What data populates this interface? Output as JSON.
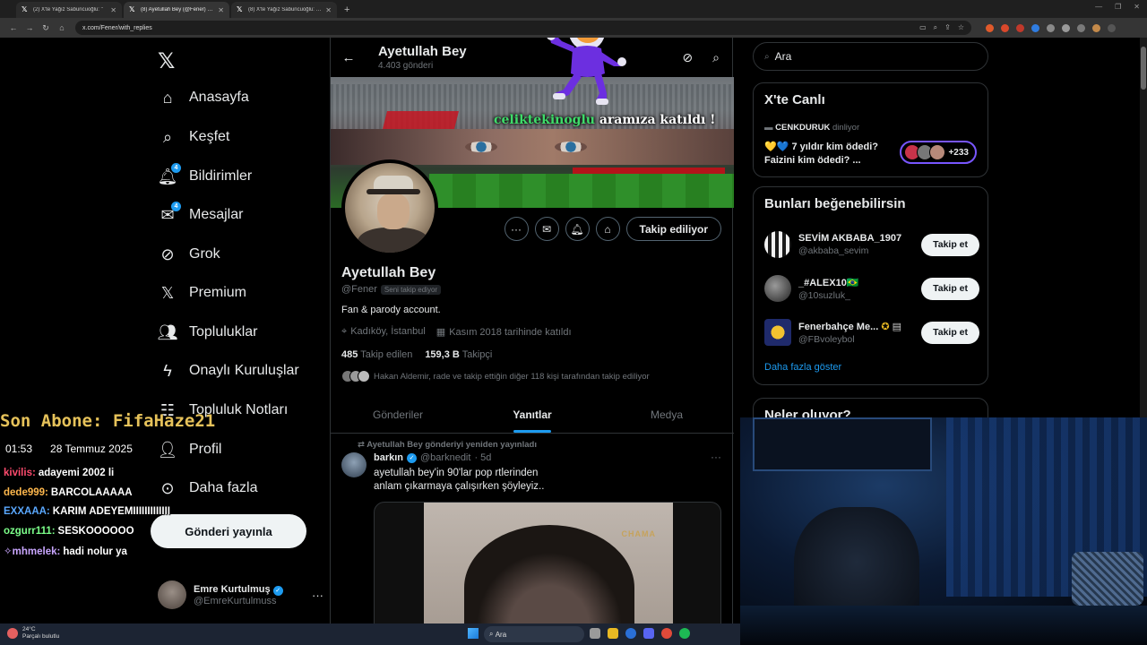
{
  "browser": {
    "tabs": [
      {
        "title": "(2) X'te Yağız Sabuncuoğlu: \"",
        "active": false
      },
      {
        "title": "(8) Ayetullah Bey (@Fener) adlı",
        "active": true
      },
      {
        "title": "(8) X'te Yağız Sabuncuoğlu: \"@",
        "active": false
      }
    ],
    "new_tab": "+",
    "url": "x.com/Fener/with_replies"
  },
  "nav": {
    "items": [
      {
        "label": "Anasayfa",
        "icon": "home-icon",
        "badge": ""
      },
      {
        "label": "Keşfet",
        "icon": "search-icon",
        "badge": ""
      },
      {
        "label": "Bildirimler",
        "icon": "bell-icon",
        "badge": "4"
      },
      {
        "label": "Mesajlar",
        "icon": "mail-icon",
        "badge": "4"
      },
      {
        "label": "Grok",
        "icon": "grok-icon",
        "badge": ""
      },
      {
        "label": "Premium",
        "icon": "x-icon",
        "badge": ""
      },
      {
        "label": "Topluluklar",
        "icon": "people-icon",
        "badge": ""
      },
      {
        "label": "Onaylı Kuruluşlar",
        "icon": "lightning-icon",
        "badge": ""
      },
      {
        "label": "Topluluk Notları",
        "icon": "notes-icon",
        "badge": ""
      },
      {
        "label": "Profil",
        "icon": "person-icon",
        "badge": ""
      },
      {
        "label": "Daha fazla",
        "icon": "more-circle-icon",
        "badge": ""
      }
    ],
    "post_button": "Gönderi yayınla",
    "account": {
      "name": "Emre Kurtulmuş",
      "handle": "@EmreKurtulmuss"
    }
  },
  "profile": {
    "header_name": "Ayetullah Bey",
    "post_count": "4.403 gönderi",
    "banner_text_user": "celiktekinoglu",
    "banner_text_rest": " aramıza katıldı !",
    "name": "Ayetullah Bey",
    "handle": "@Fener",
    "follows_you": "Seni takip ediyor",
    "bio": "Fan & parody account.",
    "location": "Kadıköy, İstanbul",
    "joined": "Kasım 2018 tarihinde katıldı",
    "following_count": "485",
    "following_label": "Takip edilen",
    "followers_count": "159,3 B",
    "followers_label": "Takipçi",
    "mutual_text": "Hakan Aldemir, rade ve takip ettiğin diğer 118 kişi tarafından takip ediliyor",
    "follow_button": "Takip ediliyor",
    "tabs": [
      {
        "label": "Gönderiler",
        "active": false
      },
      {
        "label": "Yanıtlar",
        "active": true
      },
      {
        "label": "Medya",
        "active": false
      }
    ]
  },
  "tweet": {
    "retweet_line": "Ayetullah Bey gönderiyi yeniden yayınladı",
    "author_name": "barkın",
    "author_handle": "@barknedit",
    "time": "· 5d",
    "text_line1": "ayetullah bey'in 90'lar pop rtlerinden",
    "text_line2": "anlam çıkarmaya çalışırken şöyleyiz..",
    "media_text": "CHAMA"
  },
  "right": {
    "search_placeholder": "Ara",
    "live": {
      "title": "X'te Canlı",
      "host": "CENKDURUK",
      "host_suffix": "dinliyor",
      "space_line1": "💛💙 7 yıldır kim ödedi?",
      "space_line2": "Faizini kim ödedi? ...",
      "listener_count": "+233"
    },
    "suggestions": {
      "title": "Bunları beğenebilirsin",
      "items": [
        {
          "name": "SEVİM AKBABA_1907",
          "handle": "@akbaba_sevim",
          "button": "Takip et",
          "color": "#d7d7d7"
        },
        {
          "name": "_#ALEX10🇧🇷",
          "handle": "@10suzluk_",
          "button": "Takip et",
          "color": "#5a5a5a"
        },
        {
          "name": "Fenerbahçe Me...",
          "handle": "@FBvoleybol",
          "button": "Takip et",
          "color": "#1f2a6b"
        }
      ],
      "more": "Daha fazla göster"
    },
    "happening": {
      "title": "Neler oluyor?"
    }
  },
  "overlay": {
    "subscriber": "Son Abone: FifaHaze21",
    "time": "01:53",
    "date": "28 Temmuz 2025",
    "chat": [
      {
        "user": "kivilis:",
        "msg": "adayemi 2002 li",
        "color": "#ff4b6e"
      },
      {
        "user": "dede999:",
        "msg": "BARCOLAAAAA",
        "color": "#ffb84d"
      },
      {
        "user": "EXXAAA:",
        "msg": "KARİM ADEYEMİİİİİİİİİİİİİ",
        "color": "#5aa8ff"
      },
      {
        "user": "ozgurr111:",
        "msg": "SESKOOOOOO",
        "color": "#7cff8a"
      },
      {
        "user": "mhmelek:",
        "msg": "hadi nolur ya",
        "color": "#c9a6ff"
      }
    ]
  },
  "taskbar": {
    "temp": "24°C",
    "weather": "Parçalı bulutlu",
    "search": "Ara"
  }
}
